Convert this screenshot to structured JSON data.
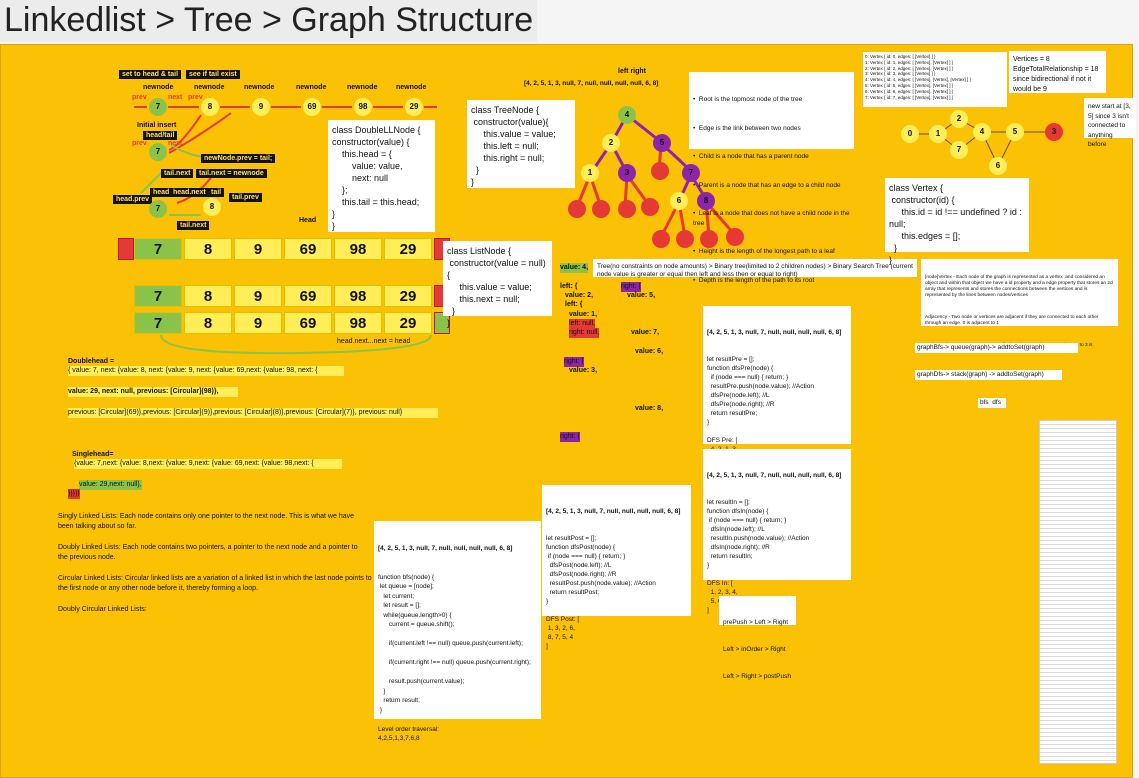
{
  "title": "Linkedlist > Tree > Graph Structure",
  "ll_labels": {
    "set_head_tail": "set to head & tail",
    "see_tail_exist": "see if tail exist",
    "newnode": "newnode",
    "prev": "prev",
    "next": "next",
    "initial_insert": "Initial insert",
    "head_tail": "head/tail",
    "new_prev_tail": "newNode.prev = tail;",
    "tail_next": "tail.next",
    "tail_next_eq": "tail.next = newnode",
    "head_prev": "head.prev",
    "head": "head",
    "head_next": "head.next",
    "tail": "tail",
    "tail_next2": "tail.next",
    "tail_prev": "tail.prev",
    "head_word": "Head",
    "head_next_eq": "head.next...next = head"
  },
  "dll_values": [
    "7",
    "8",
    "9",
    "69",
    "98",
    "29"
  ],
  "dll_top_nodes": [
    "7",
    "8",
    "9",
    "69",
    "98",
    "29"
  ],
  "dll_insert_node": "7",
  "dll_tail_node": "8",
  "dll_head_node": "7",
  "class_dll": "class DoubleLLNode {\nconstructor(value) {\n    this.head = {\n        value: value,\n        next: null\n    };\n    this.tail = this.head;\n}\n}",
  "class_list": "class ListNode {\n constructor(value = null) {\n     this.value = value;\n     this.next = null;\n  }\n}",
  "class_tree": "class TreeNode {\n constructor(value){\n     this.value = value;\n     this.left = null;\n     this.right = null;\n  }\n}",
  "class_vertex": "class Vertex {\n constructor(id) {\n     this.id = id !== undefined ? id : null;\n     this.edges = [];\n  }\n}",
  "doublehead": {
    "heading": "Doublehead =",
    "line1": "{ value: 7, next: {value: 8, next: {value: 9, next: {value: 69,next: {value: 98, next: {",
    "line2": "value: 29, next: null, previous: [Circular](98)},",
    "line3": "previous: [Circular](69)},previous: [Circular](9)},previous: [Circular](8)},previous: [Circular](7)}, previous: null}"
  },
  "singlehead": {
    "heading": "Singlehead=",
    "line1": "{value: 7,next: {value: 8,next: {value: 9,next: {value: 69,next: {value: 98,next: {",
    "line2": "value: 29,next: null},",
    "line3": "}}}}}"
  },
  "descriptions": [
    "Singly Linked Lists: Each node contains only one pointer to the next node. This is what we have been talking about so far.",
    "Doubly Linked Lists: Each node contains two pointers, a pointer to the next node and a pointer to the previous node.",
    "Circular Linked Lists: Circular linked lists are a variation of a linked list in which the last node points to the first node or any other node before it, thereby forming a loop.",
    "Doubly Circular Linked Lists:"
  ],
  "tree": {
    "left_right": "left right",
    "array": "[4, 2, 5, 1, 3, null, 7, null, null, null, null, 6, 8]",
    "nodes": [
      "4",
      "2",
      "5",
      "1",
      "3",
      "7",
      "6",
      "8"
    ]
  },
  "tree_defs": [
    "Root is the topmost node of the tree",
    "Edge is the link between two nodes",
    "Child is a node that has a parent node",
    "Parent is a node that has an edge to a child node",
    "Leaf is a node that does not have a child node in the tree",
    "Height is the length of the longest path to a leaf",
    "Depth is the length of the path to its root"
  ],
  "tree_caption": "Tree(no constraints on node amounts) > Binary tree(limited to 2 children nodes) > Binary Search Tree (current node value is greater or equal then left and less then or equal to right)",
  "tree_object": {
    "value4": "value: 4,",
    "left": "left: {",
    "value2": "value: 2,",
    "left_inner": "left: {",
    "value1": "value: 1,",
    "leftnull": "left: null,",
    "rightnull": "right: null,",
    "right": "right: {",
    "value3": "value: 3,",
    "right5": "right: {",
    "value5": "value: 5,",
    "value7": "value: 7,",
    "value6": "value: 6,",
    "value8": "value: 8,"
  },
  "bfs_code": {
    "array": "[4, 2, 5, 1, 3, null, 7, null, null, null, null, 6, 8]",
    "body": "function bfs(node) {\n let queue = [node];\n   let current;\n   let result = [];\n   while(queue.length>0) {\n      current = queue.shift();\n\n      if(current.left !== null) queue.push(current.left);\n\n      if(current.right !== null) queue.push(current.right);\n\n      result.push(current.value);\n   }\n   return result;\n }\n\nLevel order traversal:\n4,2,5,1,3,7,6,8"
  },
  "dfs_post": {
    "array": "[4, 2, 5, 1, 3, null, 7, null, null, null, null, 6, 8]",
    "body": "let resultPost = [];\nfunction dfsPost(node) {\n if (node === null) { return; }\n  dfsPost(node.left); //L\n  dfsPost(node.right); //R\n  resultPost.push(node.value); //Action\n  return resultPost;\n}\n\nDFS Post: [\n 1, 3, 2, 6,\n 8, 7, 5, 4\n]"
  },
  "dfs_pre": {
    "array": "[4, 2, 5, 1, 3, null, 7, null, null, null, null, 6, 8]",
    "body": "let resultPre = [];\nfunction dfsPre(node) {\n  if (node === null) { return; }\n  resultPre.push(node.value); //Action\n  dfsPre(node.left); //L\n  dfsPre(node.right); //R\n  return resultPre;\n}\n\nDFS Pre: [\n  4, 2, 1, 3,\n  5, 7, 6, 8\n]"
  },
  "dfs_in": {
    "array": "[4, 2, 5, 1, 3, null, 7, null, null, null, null, 6, 8]",
    "body": "let resultIn = [];\nfunction dfsIn(node) {\n if (node === null) { return; }\n  dfsIn(node.left); //L\n  resultIn.push(node.value); //Action\n  dfsIn(node.right); //R\n  return resultIn;\n}\n\nDFS In: [\n  1, 2, 3, 4,\n  5, 6, 7, 8\n]"
  },
  "orders": [
    "prePush > Left > Right",
    "Left > inOrder > Right",
    "Left > Right > postPush"
  ],
  "graph": {
    "vertices_note": "Vertices = 8\nEdgeTotalRelationship = 18\nsince bidirectional if not it would be 9",
    "start_note": "new start at [3, 5] since 3 isn't connected to anything before",
    "nodes": [
      "0",
      "1",
      "2",
      "4",
      "5",
      "3",
      "7",
      "6"
    ],
    "vertex_list": "0: Vertex { id: 0, edges: [ [Vertex] ] }\n1: Vertex { id: 1, edges: [ [Vertex], [Vertex] ] }\n2: Vertex { id: 2, edges: [ [Vertex], [Vertex] ] }\n3: Vertex { id: 3, edges: [ [Vertex] ] }\n4: Vertex { id: 4, edges: [ [Vertex], [Vertex], [Vertex] ] }\n5: Vertex { id: 5, edges: [ [Vertex], [Vertex] ] }\n6: Vertex { id: 6, edges: [ [Vertex], [Vertex] ] }\n7: Vertex { id: 7, edges: [ [Vertex], [Vertex] ] }",
    "defs": [
      "[node]Vertex - Each node of the graph is represented as a vertex  and considered an object and within that object we have a id property and a edge property that stores an 2d array that represents and stores the connections between the vertices and is represented by the lines between nodes/vertices",
      "Adjacency - Two node or vertices are adjacent if they are connected to each other through an edge. 0 is adjacent to 1",
      "Path - Path represents a sequence of edges between the two vertices. 0 to 3 is considered a path 0 -> 1 -> 2 -> 4 -> 5 -> 3"
    ],
    "bfs": "graphBfs-> queue(graph)-> addtoSet(graph)",
    "dfs": "graphDfs-> stack(graph) -> addtoSet(graph)",
    "bfs_dfs": "bfs  dfs"
  },
  "colors": {
    "board": "#fbc104",
    "green": "#8bc34a",
    "yellow": "#ffee58",
    "red": "#e53935",
    "purple": "#8e24aa",
    "teal": "#26a69a"
  }
}
